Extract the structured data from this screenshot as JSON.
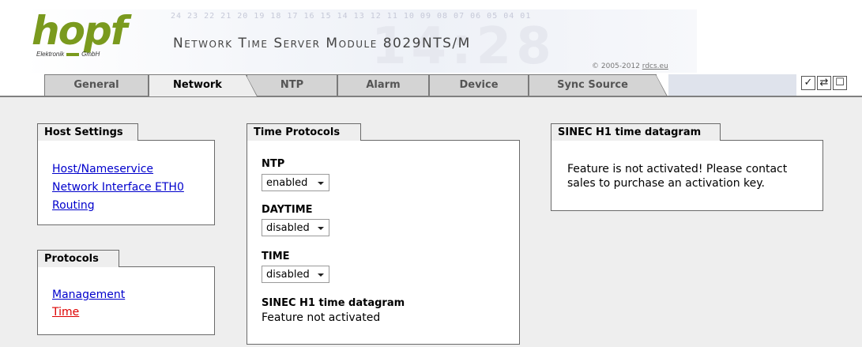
{
  "header": {
    "logo_text": "hopf",
    "logo_sub_left": "Elektronik",
    "logo_sub_right": "GmbH",
    "digits_strip": "24 23 22 21 20 19 18 17 16 15 14 13 12 11 10 09 08 07 06 05 04 01",
    "title": "Network Time Server Module 8029NTS/M",
    "copyright_prefix": "© 2005-2012 ",
    "copyright_link": "rdcs.eu",
    "accent_color": "#7a9a1e"
  },
  "tabs": [
    {
      "label": "General"
    },
    {
      "label": "Network"
    },
    {
      "label": "NTP"
    },
    {
      "label": "Alarm"
    },
    {
      "label": "Device"
    },
    {
      "label": "Sync Source"
    }
  ],
  "active_tab": "Network",
  "toolbar": {
    "icons": [
      "check-icon",
      "refresh-icon",
      "page-icon"
    ],
    "glyphs": [
      "✓",
      "⇄",
      "☐"
    ]
  },
  "host_settings": {
    "title": "Host Settings",
    "links": [
      "Host/Nameservice",
      "Network Interface ETH0",
      "Routing"
    ]
  },
  "protocols": {
    "title": "Protocols",
    "links": [
      "Management",
      "Time"
    ],
    "active": "Time"
  },
  "time_protocols": {
    "title": "Time Protocols",
    "ntp_label": "NTP",
    "ntp_value": "enabled",
    "daytime_label": "DAYTIME",
    "daytime_value": "disabled",
    "time_label": "TIME",
    "time_value": "disabled",
    "sinec_label": "SINEC H1 time datagram",
    "sinec_value": "Feature not activated"
  },
  "sinec_panel": {
    "title": "SINEC H1 time datagram",
    "message_line1": "Feature is not activated! Please contact",
    "message_line2": "sales to purchase an activation key."
  }
}
